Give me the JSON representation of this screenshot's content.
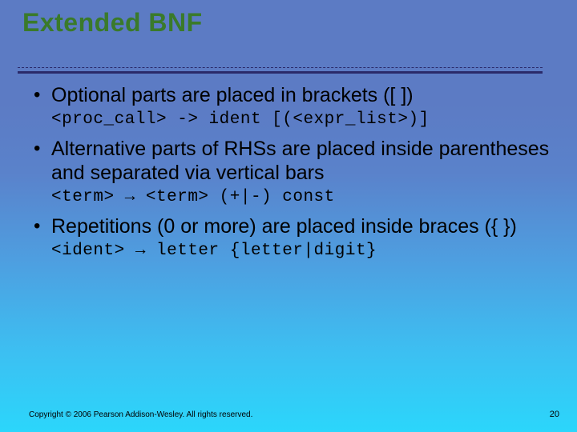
{
  "title": "Extended BNF",
  "bullets": [
    {
      "text": "Optional parts are placed in brackets ([ ])",
      "code": "<proc_call> -> ident [(<expr_list>)]"
    },
    {
      "text": "Alternative parts of RHSs are placed inside parentheses and separated via vertical bars",
      "code": "<term> → <term> (+|-) const"
    },
    {
      "text": "Repetitions (0 or more) are placed inside braces ({ })",
      "code": "<ident> → letter {letter|digit}"
    }
  ],
  "footer": {
    "copyright": "Copyright © 2006 Pearson Addison-Wesley. All rights reserved.",
    "page_number": "20"
  }
}
